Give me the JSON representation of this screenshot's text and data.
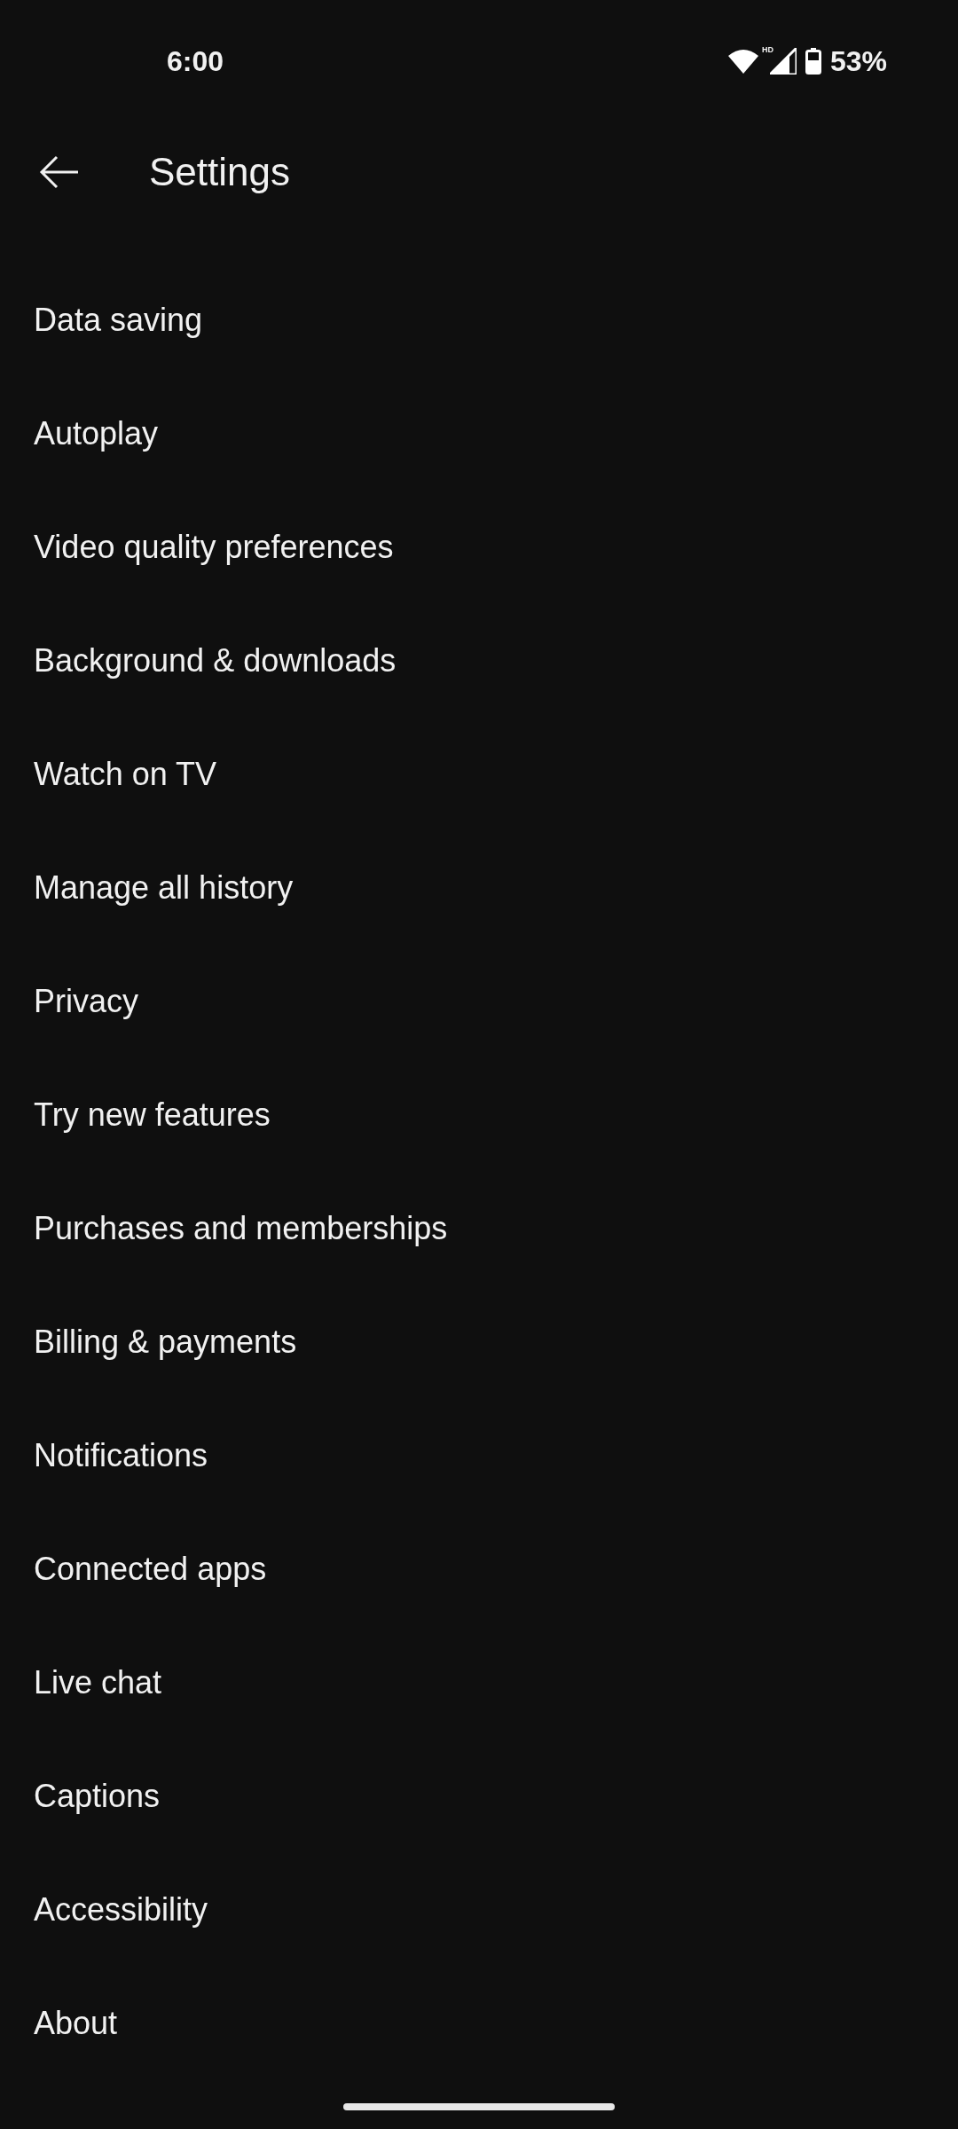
{
  "status_bar": {
    "time": "6:00",
    "network_badge": "HD",
    "battery": "53%"
  },
  "header": {
    "title": "Settings"
  },
  "items": [
    {
      "label": "Data saving"
    },
    {
      "label": "Autoplay"
    },
    {
      "label": "Video quality preferences"
    },
    {
      "label": "Background & downloads"
    },
    {
      "label": "Watch on TV"
    },
    {
      "label": "Manage all history"
    },
    {
      "label": "Privacy"
    },
    {
      "label": "Try new features"
    },
    {
      "label": "Purchases and memberships"
    },
    {
      "label": "Billing & payments"
    },
    {
      "label": "Notifications"
    },
    {
      "label": "Connected apps"
    },
    {
      "label": "Live chat"
    },
    {
      "label": "Captions"
    },
    {
      "label": "Accessibility"
    },
    {
      "label": "About"
    }
  ]
}
